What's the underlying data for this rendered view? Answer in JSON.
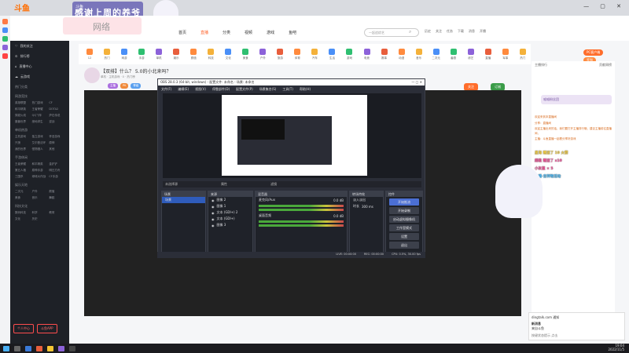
{
  "browser": {
    "active_tab": "斗鱼",
    "banner_text": "感谢上周的养爷",
    "tab2": "斗鱼直播",
    "window_controls": "— ▢ ✕"
  },
  "site": {
    "logo": "斗鱼",
    "pink_box_text": "网络",
    "nav": [
      "首页",
      "直播",
      "分类",
      "视频",
      "游戏",
      "鱼吧"
    ],
    "nav_active": "直播",
    "search_placeholder": "一起追综艺",
    "top_icons": [
      "历史",
      "关注",
      "任务",
      "下载",
      "消息",
      "开播"
    ],
    "categories": [
      "12",
      "热门",
      "网游",
      "手游",
      "单机",
      "娱乐",
      "颜值",
      "科技",
      "文化",
      "美食",
      "户外",
      "旅游",
      "体育",
      "汽车",
      "生活",
      "游戏",
      "电竞",
      "赛事",
      "动漫",
      "音乐",
      "二次元",
      "番剧",
      "综艺",
      "直播",
      "军事",
      "热门"
    ],
    "category_count_label": "12",
    "pc_badge": "PC客户端",
    "sign_badge": "签到"
  },
  "sidebar": {
    "items": [
      "我的关注",
      "排行榜",
      "直播中心",
      "云游戏"
    ],
    "section1": "热门分类",
    "section2": "网游竞技",
    "grid2": [
      "英雄联盟",
      "热门游戏",
      "CF",
      "和平精英",
      "王者荣耀",
      "DOTA2",
      "穿越火线",
      "QQ飞车",
      "炉石传说",
      "魔兽世界",
      "绝地求生",
      "逆战"
    ],
    "section3": "单机热游",
    "grid3": [
      "主机游戏",
      "独立游戏",
      "怀旧游戏",
      "只狼",
      "艾尔登法环",
      "原神",
      "我的世界",
      "怪物猎人",
      "其他"
    ],
    "section4": "手游休闲",
    "grid4": [
      "王者荣耀",
      "和平精英",
      "金铲铲",
      "第五人格",
      "原神手游",
      "明日方舟",
      "三国杀",
      "球球大作战",
      "CF手游"
    ],
    "section5": "娱乐天地",
    "grid5": [
      "二次元",
      "户外",
      "颜值",
      "美食",
      "音乐",
      "舞蹈"
    ],
    "section6": "科技文化",
    "grid6": [
      "数码科技",
      "科学",
      "教育",
      "文化",
      "历史"
    ],
    "btn1": "个人中心",
    "btn2": "斗鱼APP"
  },
  "room": {
    "title": "【双排】什么？ 5.0的小北来吗？",
    "subtitle": "单机 · 主机游戏 · 0 · 热门榜",
    "tags": [
      "主播",
      "PK",
      "等级"
    ],
    "follow": "关注",
    "follow_count": "订阅"
  },
  "obs": {
    "title": "OBS 28.0.3 (64-bit, windows) - 配置文件: 未命名 - 场景: 未命名",
    "menu": [
      "文件(F)",
      "编辑(E)",
      "视图(V)",
      "停靠部件(D)",
      "配置文件(P)",
      "场景集合(S)",
      "工具(T)",
      "帮助(H)"
    ],
    "scene_bar": [
      "未选择源",
      "属性",
      "滤镜"
    ],
    "docks": {
      "scenes": {
        "title": "场景",
        "items": [
          "场景"
        ]
      },
      "sources": {
        "title": "来源",
        "items": [
          "图像 2",
          "图像 1",
          "文本 (GDI+) 2",
          "文本 (GDI+)",
          "图像 3"
        ]
      },
      "mixer": {
        "title": "混音器",
        "items": [
          "麦克风/Aux",
          "桌面音频"
        ],
        "levels": [
          "0.0 dB",
          "0.0 dB"
        ]
      },
      "transitions": {
        "title": "转场特效",
        "items": [
          "淡入淡出",
          "时长",
          "300 ms"
        ]
      },
      "controls": {
        "title": "控件",
        "buttons": [
          "开始推流",
          "开始录制",
          "启动虚拟摄像机",
          "工作室模式",
          "设置",
          "退出"
        ]
      }
    },
    "status": [
      "LIVE: 00:00:00",
      "REC: 00:00:00",
      "CPU: 0.5%, 30.00 fps"
    ]
  },
  "chat": {
    "header": [
      "主播排行",
      "贡献周榜"
    ],
    "promo": "喵喵粉丝团",
    "messages": [
      "欢迎来到本直播间",
      "分享：直播间",
      "欢迎主播出来的话，我们要打开主播排行哦，建议主播前往直播间，",
      "主播：斗鱼直播一起看分享好游戏"
    ],
    "gift_lines": [
      "星海 赠送了 10 火箭",
      "超级 赠送了 x10",
      "小灰鼠 × 5",
      "主播·吉祥物活动"
    ]
  },
  "notification": {
    "source": "dingtalk.com 通知",
    "title": "新消息",
    "body": "来自斗鱼",
    "footer": "按键状态提示 点击"
  },
  "taskbar": {
    "time": "19:04",
    "date": "2022/11/5"
  },
  "colors": {
    "accent": "#ff6d2b",
    "obs_selection": "#2f5cbb",
    "sidebar_bg": "#1e2127"
  }
}
